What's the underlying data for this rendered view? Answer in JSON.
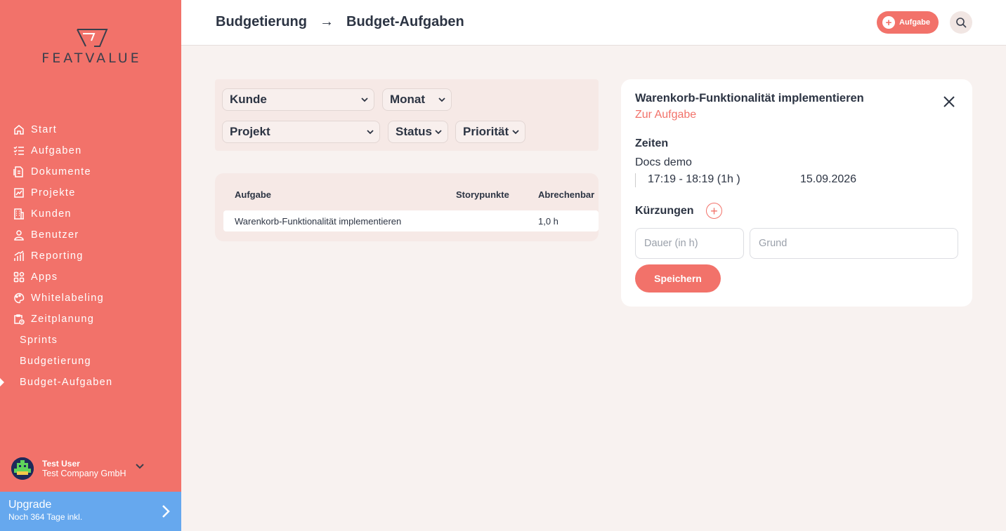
{
  "brand": {
    "name": "FEATVALUE",
    "accent": "#f2726a",
    "upgrade_color": "#66a8ee"
  },
  "sidebar": {
    "items": [
      {
        "label": "Start",
        "icon": "home-icon"
      },
      {
        "label": "Aufgaben",
        "icon": "tasks-icon"
      },
      {
        "label": "Dokumente",
        "icon": "documents-icon"
      },
      {
        "label": "Projekte",
        "icon": "projects-icon"
      },
      {
        "label": "Kunden",
        "icon": "building-icon"
      },
      {
        "label": "Benutzer",
        "icon": "user-icon"
      },
      {
        "label": "Reporting",
        "icon": "chart-icon"
      },
      {
        "label": "Apps",
        "icon": "apps-icon"
      },
      {
        "label": "Whitelabeling",
        "icon": "palette-icon"
      },
      {
        "label": "Zeitplanung",
        "icon": "clipboard-clock-icon"
      }
    ],
    "subitems": [
      {
        "label": "Sprints"
      },
      {
        "label": "Budgetierung"
      },
      {
        "label": "Budget-Aufgaben",
        "active": true
      }
    ]
  },
  "user": {
    "name": "Test User",
    "company": "Test Company GmbH"
  },
  "upgrade": {
    "title": "Upgrade",
    "subtitle": "Noch 364 Tage inkl."
  },
  "header": {
    "breadcrumb": [
      "Budgetierung",
      "Budget-Aufgaben"
    ],
    "arrow": "→",
    "add_label": "Aufgabe"
  },
  "filters": {
    "kunde": "Kunde",
    "monat": "Monat",
    "projekt": "Projekt",
    "status": "Status",
    "prioritaet": "Priorität"
  },
  "table": {
    "columns": [
      "Aufgabe",
      "Storypunkte",
      "Abrechenbar"
    ],
    "rows": [
      {
        "aufgabe": "Warenkorb-Funktionalität implementieren",
        "storypunkte": "",
        "abrechenbar": "1,0 h"
      }
    ]
  },
  "detail": {
    "title": "Warenkorb-Funktionalität implementieren",
    "link": "Zur Aufgabe",
    "zeiten_title": "Zeiten",
    "time_project": "Docs demo",
    "time_range": "17:19 - 18:19 (1h )",
    "time_date": "15.09.2026",
    "kuerzungen_title": "Kürzungen",
    "dauer_placeholder": "Dauer (in h)",
    "grund_placeholder": "Grund",
    "save_label": "Speichern"
  }
}
